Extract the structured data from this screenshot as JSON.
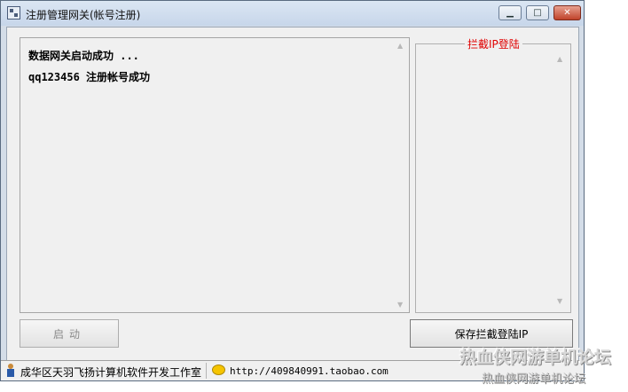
{
  "window": {
    "title": "注册管理网关(帐号注册)",
    "controls": {
      "minimize": "▁",
      "maximize": "□",
      "close": "✕"
    }
  },
  "log": {
    "lines": [
      "数据网关启动成功 ...",
      "qq123456 注册帐号成功"
    ]
  },
  "ip_panel": {
    "legend": "拦截IP登陆"
  },
  "buttons": {
    "start": "启动",
    "save": "保存拦截登陆IP"
  },
  "statusbar": {
    "author": "成华区天羽飞扬计算机软件开发工作室",
    "url": "http://409840991.taobao.com"
  },
  "watermark": {
    "main": "热血侠网游单机论坛",
    "sub": "热血侠网游单机论坛"
  },
  "icons": {
    "app": "app-icon",
    "scroll_up": "scroll-up-arrow-icon",
    "scroll_down": "scroll-down-arrow-icon",
    "person": "person-icon",
    "chat": "chat-bubble-icon"
  },
  "colors": {
    "legend": "#e00000",
    "titlebar": "#c7d6ea",
    "client": "#f0f0f0"
  }
}
